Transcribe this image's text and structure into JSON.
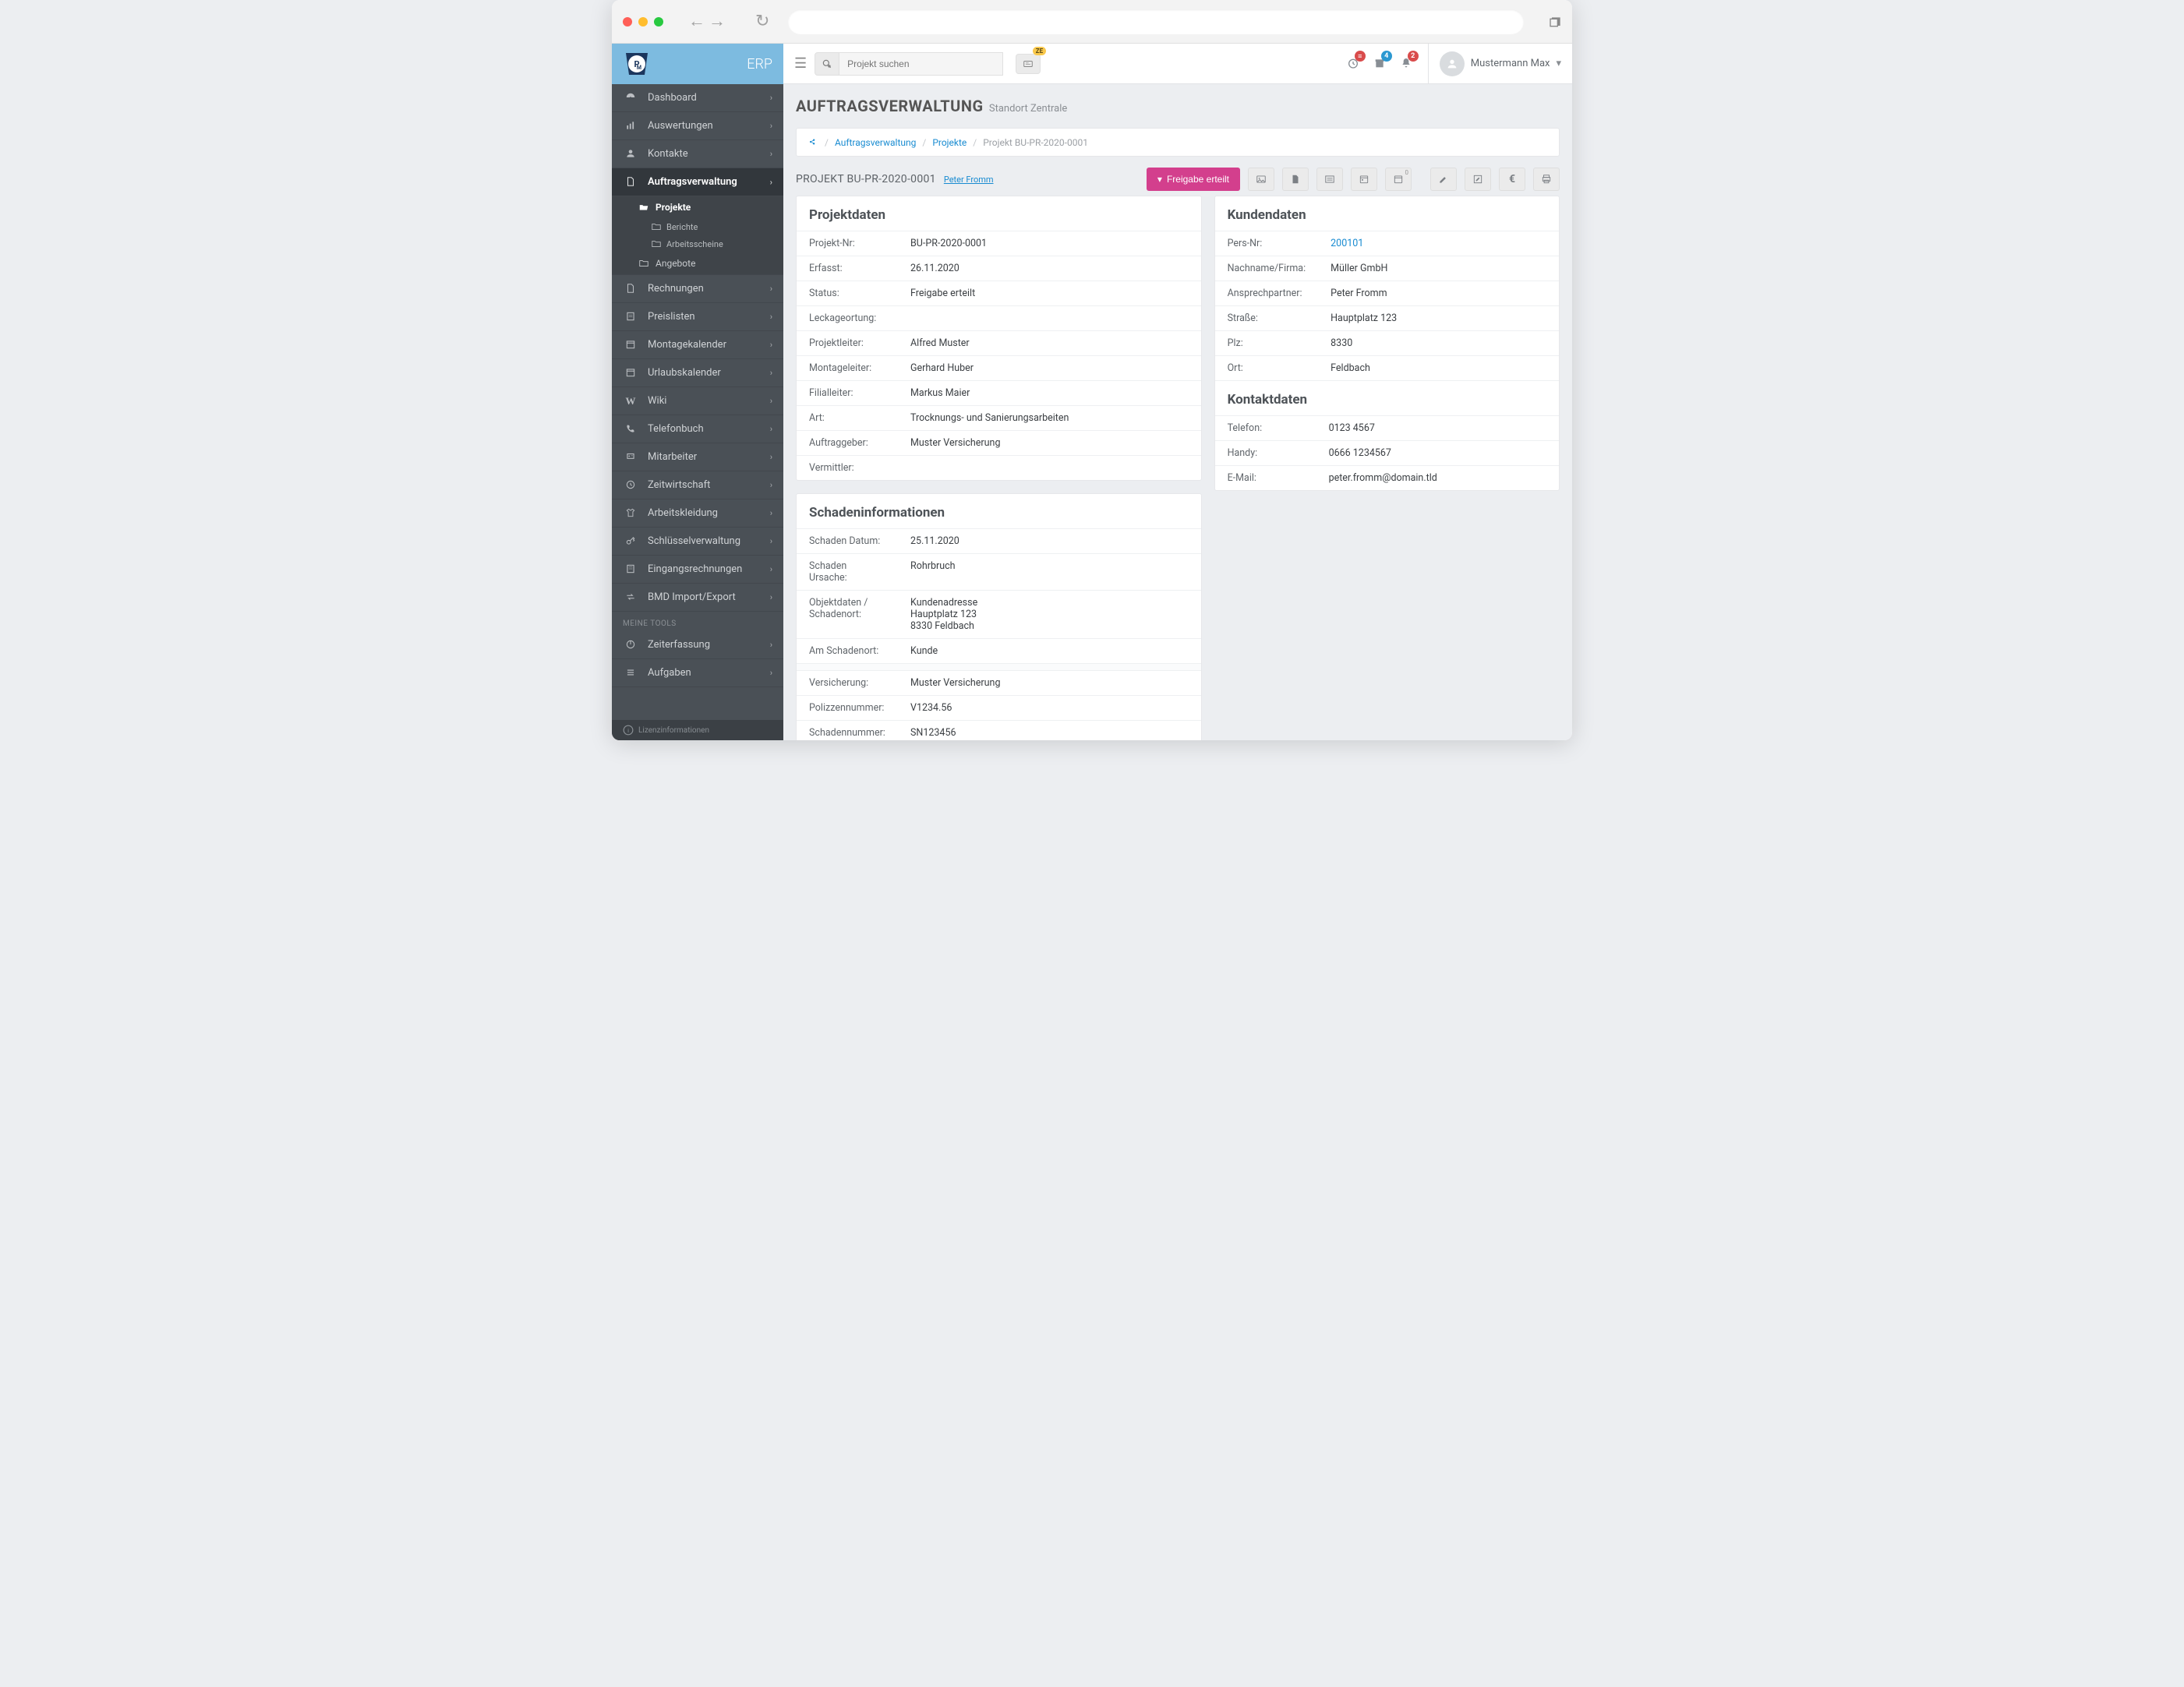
{
  "logo_text": "ERP",
  "user": {
    "name": "Mustermann Max"
  },
  "search": {
    "placeholder": "Projekt suchen"
  },
  "ze_badge": "ZE",
  "topbar_badges": {
    "clock": "",
    "archive": "4",
    "bell": "2"
  },
  "sidebar": {
    "items": [
      {
        "icon": "dashboard",
        "label": "Dashboard"
      },
      {
        "icon": "chart",
        "label": "Auswertungen"
      },
      {
        "icon": "user",
        "label": "Kontakte"
      },
      {
        "icon": "doc",
        "label": "Auftragsverwaltung",
        "active": true
      },
      {
        "icon": "doc",
        "label": "Rechnungen"
      },
      {
        "icon": "price",
        "label": "Preislisten"
      },
      {
        "icon": "calendar",
        "label": "Montagekalender"
      },
      {
        "icon": "calendar",
        "label": "Urlaubskalender"
      },
      {
        "icon": "wiki",
        "label": "Wiki"
      },
      {
        "icon": "phone",
        "label": "Telefonbuch"
      },
      {
        "icon": "users",
        "label": "Mitarbeiter"
      },
      {
        "icon": "clock",
        "label": "Zeitwirtschaft"
      },
      {
        "icon": "shirt",
        "label": "Arbeitskleidung"
      },
      {
        "icon": "key",
        "label": "Schlüsselverwaltung"
      },
      {
        "icon": "inbox",
        "label": "Eingangsrechnungen"
      },
      {
        "icon": "exchange",
        "label": "BMD Import/Export"
      }
    ],
    "sub_active": {
      "label": "Projekte",
      "items": [
        "Berichte",
        "Arbeitsscheine"
      ]
    },
    "sub_other": {
      "label": "Angebote"
    },
    "tools_label": "MEINE TOOLS",
    "tools": [
      {
        "icon": "power",
        "label": "Zeiterfassung"
      },
      {
        "icon": "tasks",
        "label": "Aufgaben"
      }
    ],
    "license": "Lizenzinformationen"
  },
  "page": {
    "title": "AUFTRAGSVERWALTUNG",
    "subtitle": "Standort Zentrale",
    "breadcrumb": {
      "a": "Auftragsverwaltung",
      "b": "Projekte",
      "c": "Projekt BU-PR-2020-0001"
    },
    "project_label": "PROJEKT BU-PR-2020-0001",
    "project_assignee": "Peter Fromm",
    "release_btn": "Freigabe erteilt"
  },
  "projektdaten": {
    "heading": "Projektdaten",
    "rows": [
      {
        "k": "Projekt-Nr:",
        "v": "BU-PR-2020-0001"
      },
      {
        "k": "Erfasst:",
        "v": "26.11.2020"
      },
      {
        "k": "Status:",
        "v": "Freigabe erteilt"
      },
      {
        "k": "Leckageortung:",
        "v": ""
      },
      {
        "k": "Projektleiter:",
        "v": "Alfred Muster"
      },
      {
        "k": "Montageleiter:",
        "v": "Gerhard Huber"
      },
      {
        "k": "Filialleiter:",
        "v": "Markus Maier"
      },
      {
        "k": "Art:",
        "v": "Trocknungs- und Sanierungsarbeiten"
      },
      {
        "k": "Auftraggeber:",
        "v": "Muster Versicherung"
      },
      {
        "k": "Vermittler:",
        "v": ""
      }
    ]
  },
  "kundendaten": {
    "heading": "Kundendaten",
    "rows": [
      {
        "k": "Pers-Nr:",
        "v": "200101",
        "link": true
      },
      {
        "k": "Nachname/Firma:",
        "v": "Müller GmbH"
      },
      {
        "k": "Ansprechpartner:",
        "v": "Peter Fromm"
      },
      {
        "k": "Straße:",
        "v": "Hauptplatz 123"
      },
      {
        "k": "Plz:",
        "v": "8330"
      },
      {
        "k": "Ort:",
        "v": "Feldbach"
      }
    ]
  },
  "kontaktdaten": {
    "heading": "Kontaktdaten",
    "rows": [
      {
        "k": "Telefon:",
        "v": "0123 4567"
      },
      {
        "k": "Handy:",
        "v": "0666 1234567"
      },
      {
        "k": "E-Mail:",
        "v": "peter.fromm@domain.tld"
      }
    ]
  },
  "schaden": {
    "heading": "Schadeninformationen",
    "rows": [
      {
        "k": "Schaden Datum:",
        "v": "25.11.2020"
      },
      {
        "k": "Schaden Ursache:",
        "v": "Rohrbruch"
      },
      {
        "k": "Objektdaten / Schadenort:",
        "v": "Kundenadresse\nHauptplatz 123\n8330 Feldbach"
      },
      {
        "k": "Am Schadenort:",
        "v": "Kunde"
      }
    ],
    "rows2": [
      {
        "k": "Versicherung:",
        "v": "Muster Versicherung"
      },
      {
        "k": "Polizzennummer:",
        "v": "V1234.56"
      },
      {
        "k": "Schadennummer:",
        "v": "SN123456"
      }
    ]
  }
}
